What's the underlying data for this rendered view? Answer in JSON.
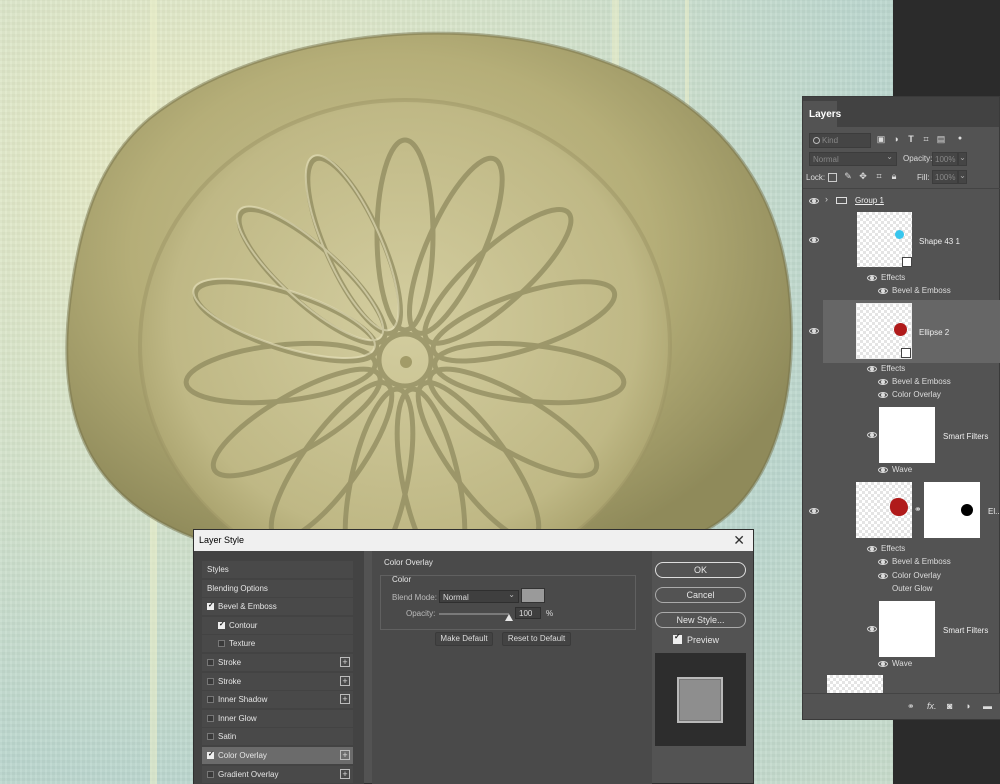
{
  "layers_panel": {
    "tab_label": "Layers",
    "kind_placeholder": "Kind",
    "blend_mode": "Normal",
    "opacity_label": "Opacity:",
    "opacity_value": "100%",
    "lock_label": "Lock:",
    "fill_label": "Fill:",
    "fill_value": "100%",
    "layers": {
      "group": "Group 1",
      "shape": "Shape 43 1",
      "ellipse2": "Ellipse 2",
      "smart_filters": "Smart Filters",
      "truncated": "El..."
    },
    "effects_label": "Effects",
    "fx": {
      "bevel": "Bevel & Emboss",
      "color_overlay": "Color Overlay",
      "outer_glow": "Outer Glow",
      "wave": "Wave"
    },
    "footer_fx": "fx."
  },
  "dialog": {
    "title": "Layer Style",
    "close_glyph": "✕",
    "styles_header": "Styles",
    "blending_options": "Blending Options",
    "items": [
      {
        "label": "Bevel & Emboss",
        "checked": true,
        "plus": false
      },
      {
        "label": "Contour",
        "checked": true,
        "plus": false
      },
      {
        "label": "Texture",
        "checked": false,
        "plus": false
      },
      {
        "label": "Stroke",
        "checked": false,
        "plus": true
      },
      {
        "label": "Stroke",
        "checked": false,
        "plus": true
      },
      {
        "label": "Inner Shadow",
        "checked": false,
        "plus": true
      },
      {
        "label": "Inner Glow",
        "checked": false,
        "plus": false
      },
      {
        "label": "Satin",
        "checked": false,
        "plus": false
      },
      {
        "label": "Color Overlay",
        "checked": true,
        "plus": true
      },
      {
        "label": "Gradient Overlay",
        "checked": false,
        "plus": true
      }
    ],
    "section_title": "Color Overlay",
    "group_title": "Color",
    "blend_mode_label": "Blend Mode:",
    "blend_mode_value": "Normal",
    "overlay_color": "#9a9a9a",
    "opacity_label": "Opacity:",
    "opacity_value": "100",
    "opacity_unit": "%",
    "opacity_fraction": 1.0,
    "make_default": "Make Default",
    "reset_default": "Reset to Default",
    "ok": "OK",
    "cancel": "Cancel",
    "new_style": "New Style...",
    "preview": "Preview"
  },
  "colors": {
    "panel_bg": "#535353",
    "seal": "#b9b27a",
    "ellipse_red": "#b01a1a",
    "shape_cyan": "#37c6ee"
  }
}
